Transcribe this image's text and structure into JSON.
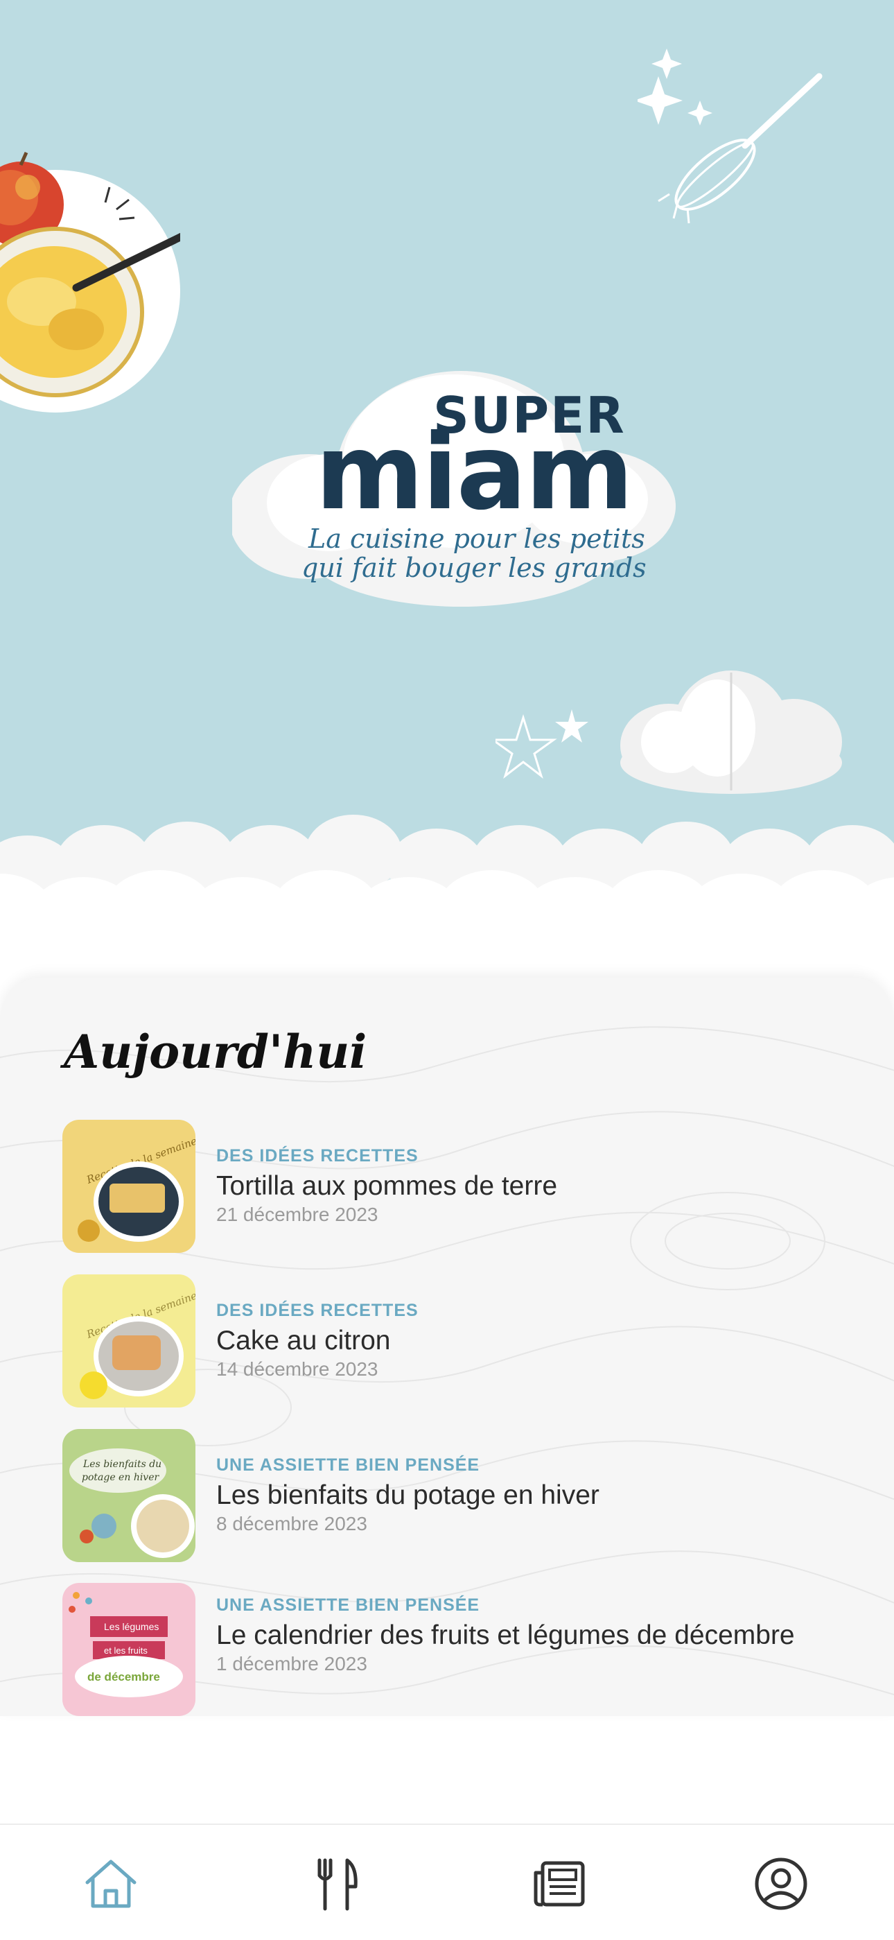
{
  "app": {
    "logo_super": "SUPER",
    "logo_miam": "miam",
    "tagline_line1": "La cuisine pour les petits",
    "tagline_line2": "qui fait bouger les grands"
  },
  "colors": {
    "hero_bg": "#bcdce2",
    "accent": "#6aa9c2",
    "logo_navy": "#1c3a52",
    "active_tab": "#6aa9c2",
    "inactive_tab": "#333333"
  },
  "today": {
    "heading": "Aujourd'hui",
    "items": [
      {
        "category": "DES IDÉES RECETTES",
        "title": "Tortilla aux pommes de terre",
        "date": "21 décembre 2023",
        "thumb_label": "Recette de la semaine",
        "thumb_color": "#f1d57a"
      },
      {
        "category": "DES IDÉES RECETTES",
        "title": "Cake au citron",
        "date": "14 décembre 2023",
        "thumb_label": "Recette de la semaine",
        "thumb_color": "#f4ec93"
      },
      {
        "category": "UNE ASSIETTE BIEN PENSÉE",
        "title": "Les bienfaits du potage en hiver",
        "date": "8 décembre 2023",
        "thumb_label_1": "Les bienfaits du",
        "thumb_label_2": "potage en hiver",
        "thumb_color": "#b9d48a"
      },
      {
        "category": "UNE ASSIETTE BIEN PENSÉE",
        "title": "Le calendrier des fruits et légumes de décembre",
        "date": "1 décembre 2023",
        "thumb_label_1": "Les légumes",
        "thumb_label_2": "et les fruits",
        "thumb_label_3": "de décembre",
        "thumb_color": "#f6c6d4"
      }
    ]
  },
  "tabbar": {
    "tabs": [
      {
        "icon": "home-icon",
        "active": true
      },
      {
        "icon": "fork-knife-icon",
        "active": false
      },
      {
        "icon": "newspaper-icon",
        "active": false
      },
      {
        "icon": "user-icon",
        "active": false
      }
    ]
  }
}
